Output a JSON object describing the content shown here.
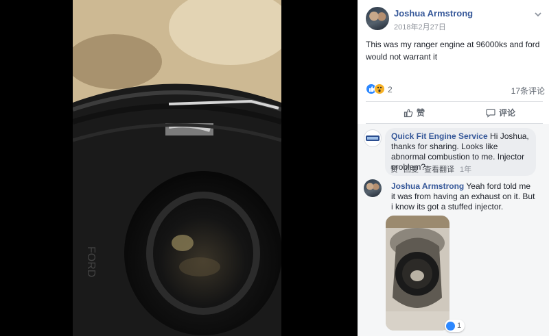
{
  "post": {
    "author": "Joshua Armstrong",
    "time": "2018年2月27日",
    "text": "This was my ranger engine at 96000ks and ford would not warrant it",
    "reaction_count": "2",
    "comment_count": "17条评论"
  },
  "actions": {
    "like": "赞",
    "comment": "评论"
  },
  "comments": [
    {
      "author": "Quick Fit Engine Service",
      "text": " Hi Joshua, thanks for sharing. Looks like abnormal combustion to me. Injector problem?",
      "like": "赞",
      "reply": "回复",
      "translate": "查看翻译",
      "time": "1年"
    },
    {
      "author": "Joshua Armstrong",
      "text": " Yeah ford told me it was from having an exhaust on it. But i know its got a stuffed injector.",
      "image_reactions": "1"
    }
  ],
  "colors": {
    "link": "#365899",
    "like_blue": "#2d88ff",
    "wow_yellow": "#f7b125"
  },
  "icons": {
    "options": "chevron-down-icon",
    "like": "thumbs-up-icon",
    "comment": "speech-bubble-icon"
  }
}
